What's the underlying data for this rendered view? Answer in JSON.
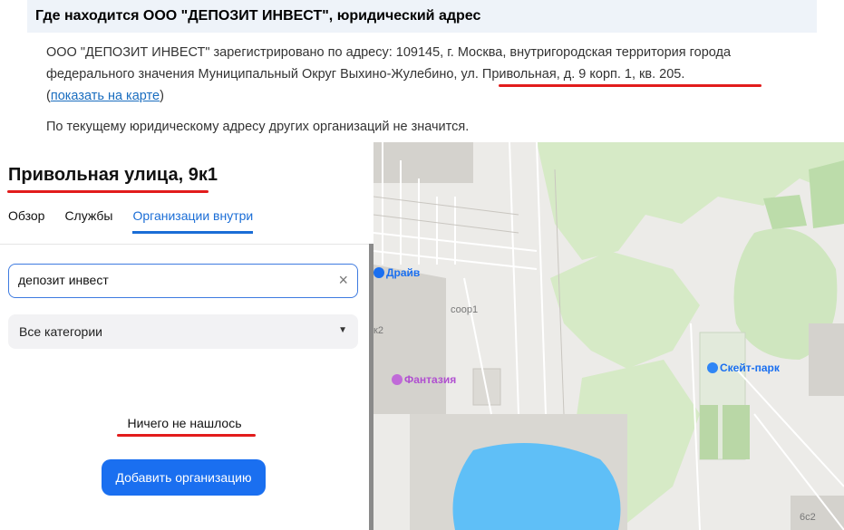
{
  "article": {
    "heading": "Где находится ООО \"ДЕПОЗИТ ИНВЕСТ\", юридический адрес",
    "line1": "ООО \"ДЕПОЗИТ ИНВЕСТ\" зарегистрировано по адресу: 109145, г. Москва, внутригородская территория города",
    "line2": "федерального значения Муниципальный Округ Выхино-Жулебино, ул. Привольная, д. 9 корп. 1, кв. 205.",
    "open_paren": "(",
    "map_link": "показать на карте",
    "close_paren": ")",
    "no_other_orgs": "По текущему юридическому адресу других организаций не значится."
  },
  "panel": {
    "title": "Привольная улица, 9к1",
    "tabs": [
      {
        "label": "Обзор",
        "active": false
      },
      {
        "label": "Службы",
        "active": false
      },
      {
        "label": "Организации внутри",
        "active": true
      }
    ],
    "search_value": "депозит инвест",
    "clear_icon": "×",
    "category_select": "Все категории",
    "select_arrow": "▼",
    "empty_message": "Ничего не нашлось",
    "add_button": "Добавить организацию"
  },
  "map": {
    "labels": {
      "drive": "Драйв",
      "soor": "соор1",
      "k2": "к2",
      "fantasy": "Фантазия",
      "skatepark": "Скейт-парк",
      "building_6c2": "6с2"
    },
    "colors": {
      "accent": "#1a6ff0",
      "highlight": "#e21c1c",
      "water": "#5fbff7",
      "park": "#cfe6bf"
    }
  }
}
